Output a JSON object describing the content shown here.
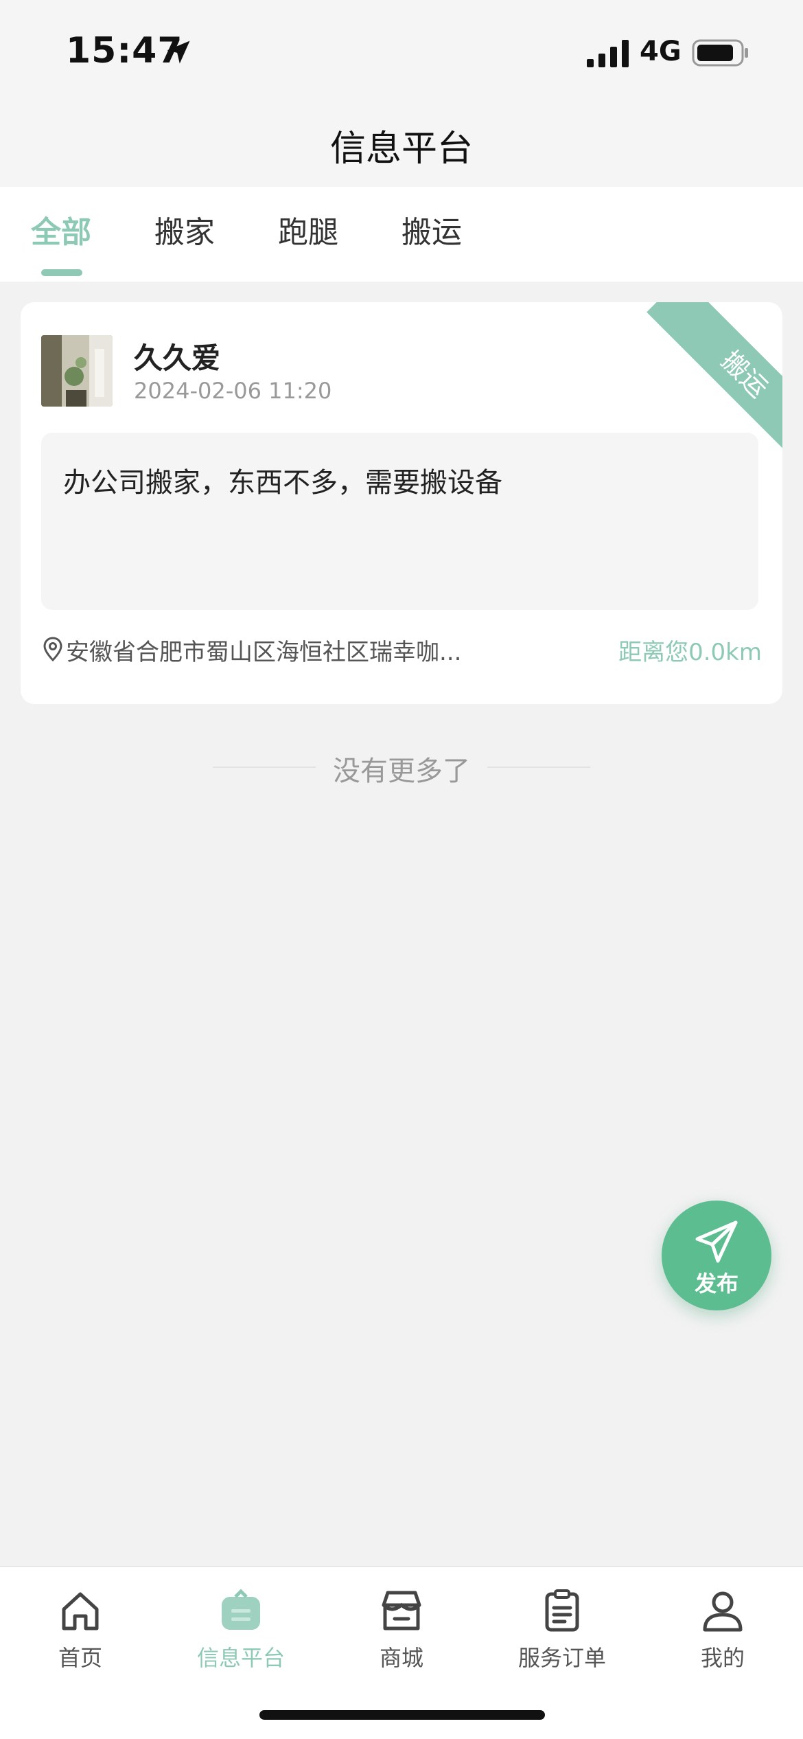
{
  "status_bar": {
    "time": "15:47",
    "network": "4G",
    "location_icon": "location-arrow-icon",
    "signal_icon": "signal-bars-icon",
    "battery_icon": "battery-icon"
  },
  "header": {
    "title": "信息平台"
  },
  "tabs": [
    {
      "label": "全部",
      "active": true
    },
    {
      "label": "搬家",
      "active": false
    },
    {
      "label": "跑腿",
      "active": false
    },
    {
      "label": "搬运",
      "active": false
    }
  ],
  "posts": [
    {
      "user_name": "久久爱",
      "time": "2024-02-06 11:20",
      "category_tag": "搬运",
      "content": "办公司搬家，东西不多，需要搬设备",
      "address": "安徽省合肥市蜀山区海恒社区瑞幸咖...",
      "distance": "距离您0.0km"
    }
  ],
  "list_end_text": "没有更多了",
  "fab": {
    "label": "发布",
    "icon": "paper-plane-icon"
  },
  "bottom_nav": [
    {
      "label": "首页",
      "icon": "home-icon",
      "active": false
    },
    {
      "label": "信息平台",
      "icon": "info-platform-icon",
      "active": true
    },
    {
      "label": "商城",
      "icon": "store-icon",
      "active": false
    },
    {
      "label": "服务订单",
      "icon": "clipboard-icon",
      "active": false
    },
    {
      "label": "我的",
      "icon": "user-icon",
      "active": false
    }
  ],
  "colors": {
    "accent": "#8ec9b5",
    "fab": "#5bbd90",
    "background": "#f2f2f2"
  }
}
